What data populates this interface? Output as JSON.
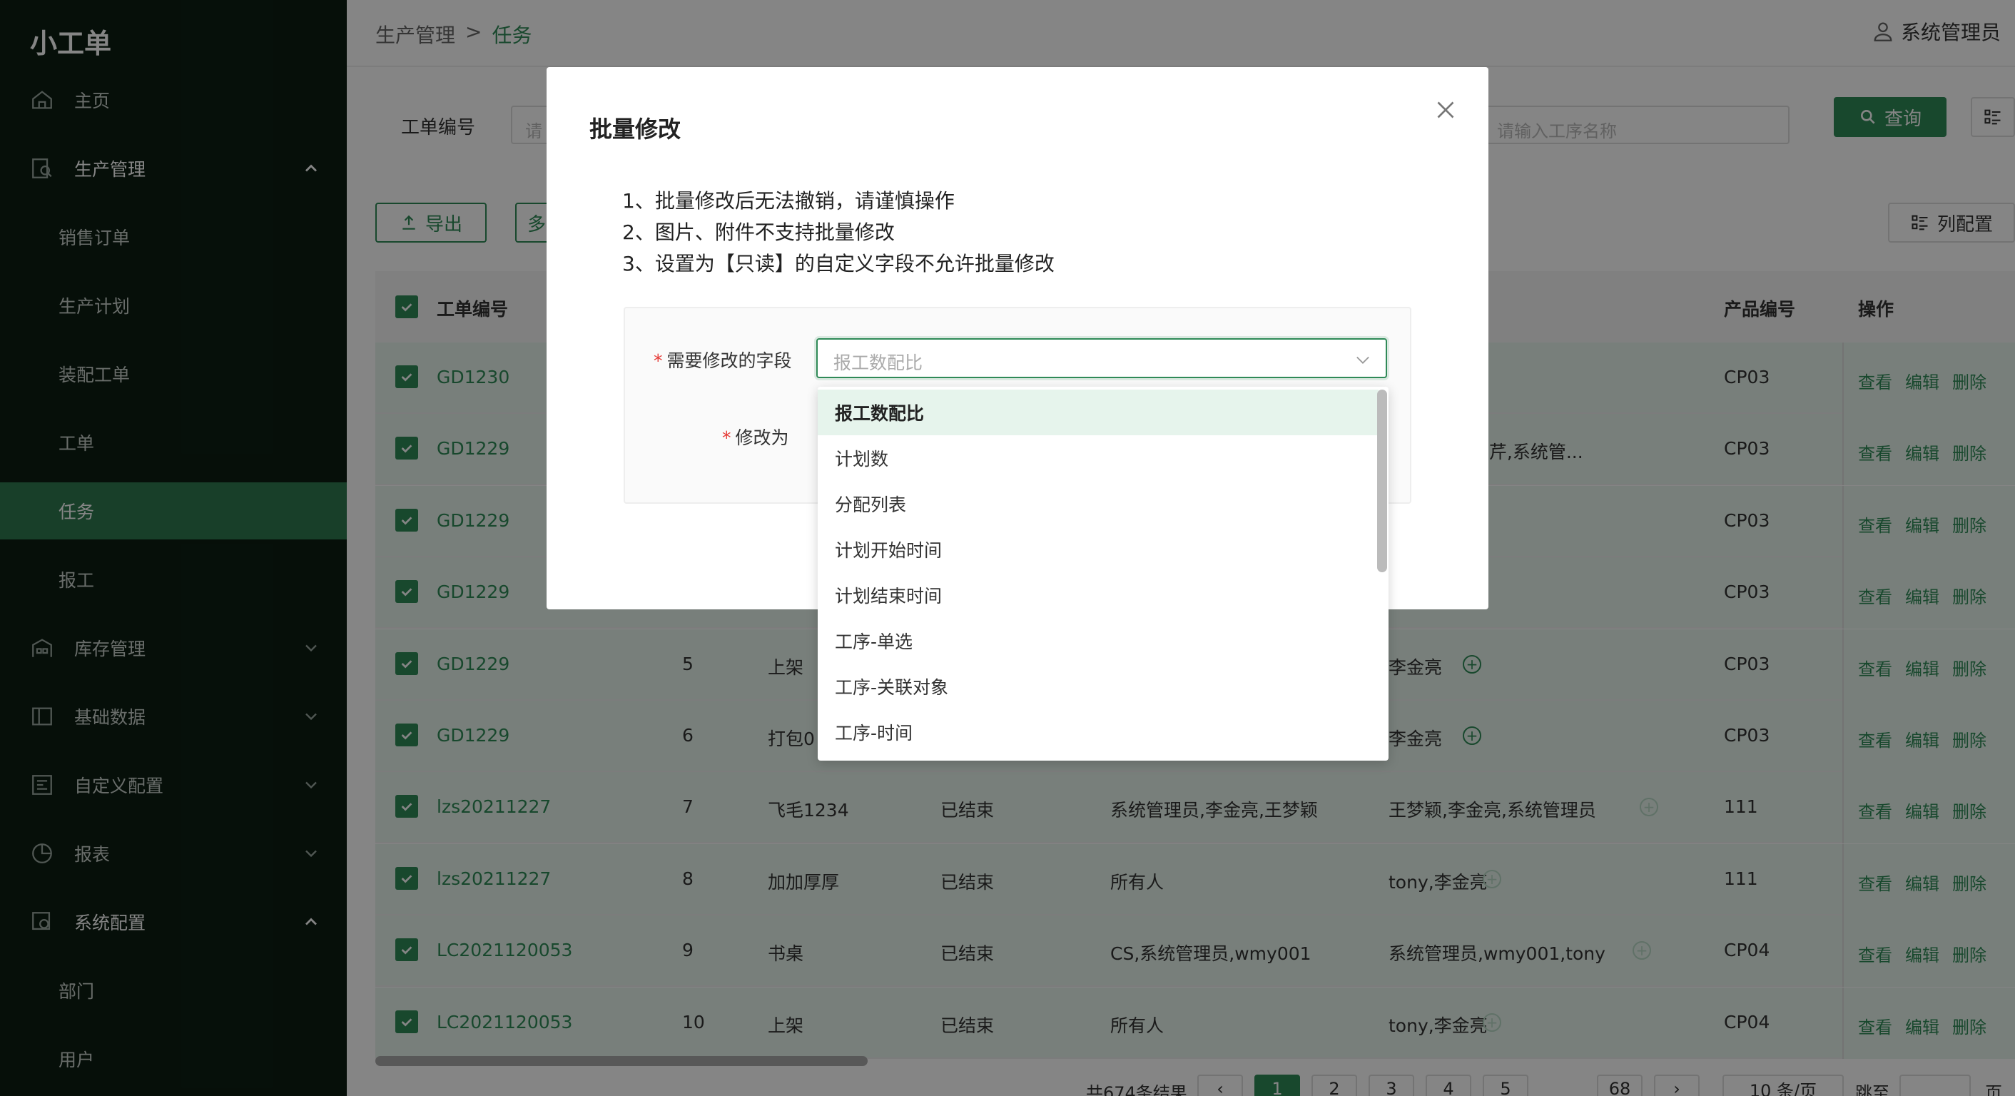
{
  "app": {
    "name": "小工单"
  },
  "sidebar": {
    "items": [
      {
        "label": "主页",
        "icon": "home-icon"
      },
      {
        "label": "生产管理",
        "icon": "production-icon"
      },
      {
        "label": "销售订单"
      },
      {
        "label": "生产计划"
      },
      {
        "label": "装配工单"
      },
      {
        "label": "工单"
      },
      {
        "label": "任务"
      },
      {
        "label": "报工"
      },
      {
        "label": "库存管理",
        "icon": "warehouse-icon"
      },
      {
        "label": "基础数据",
        "icon": "book-icon"
      },
      {
        "label": "自定义配置",
        "icon": "config-icon"
      },
      {
        "label": "报表",
        "icon": "pie-icon"
      },
      {
        "label": "系统配置",
        "icon": "system-icon"
      },
      {
        "label": "部门"
      },
      {
        "label": "用户"
      }
    ]
  },
  "header": {
    "breadcrumb": [
      "生产管理",
      ">",
      "任务"
    ],
    "user": "系统管理员"
  },
  "filters": {
    "wo_label": "工单编号",
    "wo_placeholder": "请",
    "process_placeholder": "请输入工序名称",
    "query_label": "查询"
  },
  "toolbar": {
    "export_label": "导出",
    "second_label": "多",
    "columns_label": "列配置"
  },
  "table": {
    "headers": {
      "wo": "工单编号",
      "product": "产品编号",
      "ops": "操作"
    },
    "rows": [
      {
        "wo": "GD1230",
        "seq": "",
        "process": "",
        "status": "",
        "assign": "",
        "owners": "",
        "product": "CP03"
      },
      {
        "wo": "GD1229",
        "seq": "",
        "process": "",
        "status": "",
        "assign": "",
        "owners": "梦颖,贝贝,刘芹,系统管...",
        "product": "CP03"
      },
      {
        "wo": "GD1229",
        "seq": "",
        "process": "",
        "status": "",
        "assign": "",
        "owners": "",
        "product": "CP03"
      },
      {
        "wo": "GD1229",
        "seq": "",
        "process": "",
        "status": "",
        "assign": "",
        "owners": "",
        "product": "CP03"
      },
      {
        "wo": "GD1229",
        "seq": "5",
        "process": "上架",
        "status": "",
        "assign": "",
        "owners": "李金亮",
        "product": "CP03"
      },
      {
        "wo": "GD1229",
        "seq": "6",
        "process": "打包0",
        "status": "",
        "assign": "",
        "owners": "李金亮",
        "product": "CP03"
      },
      {
        "wo": "lzs20211227",
        "seq": "7",
        "process": "飞毛1234",
        "status": "已结束",
        "assign": "系统管理员,李金亮,王梦颖",
        "owners": "王梦颖,李金亮,系统管理员",
        "product": "111"
      },
      {
        "wo": "lzs20211227",
        "seq": "8",
        "process": "加加厚厚",
        "status": "已结束",
        "assign": "所有人",
        "owners": "tony,李金亮",
        "product": "111"
      },
      {
        "wo": "LC2021120053",
        "seq": "9",
        "process": "书桌",
        "status": "已结束",
        "assign": "CS,系统管理员,wmy001",
        "owners": "系统管理员,wmy001,tony",
        "product": "CP04"
      },
      {
        "wo": "LC2021120053",
        "seq": "10",
        "process": "上架",
        "status": "已结束",
        "assign": "所有人",
        "owners": "tony,李金亮",
        "product": "CP04"
      }
    ],
    "ops": {
      "view": "查看",
      "edit": "编辑",
      "delete": "删除"
    }
  },
  "pager": {
    "total": "共674条结果",
    "pages": [
      "1",
      "2",
      "3",
      "4",
      "5"
    ],
    "last": "68",
    "size": "10 条/页",
    "jump": "跳至",
    "page_suffix": "页"
  },
  "modal": {
    "title": "批量修改",
    "notes": [
      "1、批量修改后无法撤销，请谨慎操作",
      "2、图片、附件不支持批量修改",
      "3、设置为【只读】的自定义字段不允许批量修改"
    ],
    "field_label": "需要修改的字段",
    "value_label": "修改为",
    "select_value": "报工数配比",
    "options": [
      "报工数配比",
      "计划数",
      "分配列表",
      "计划开始时间",
      "计划结束时间",
      "工序-单选",
      "工序-关联对象",
      "工序-时间"
    ]
  },
  "colors": {
    "accent": "#2f8a57",
    "sidebar_bg": "#0c1e13"
  }
}
